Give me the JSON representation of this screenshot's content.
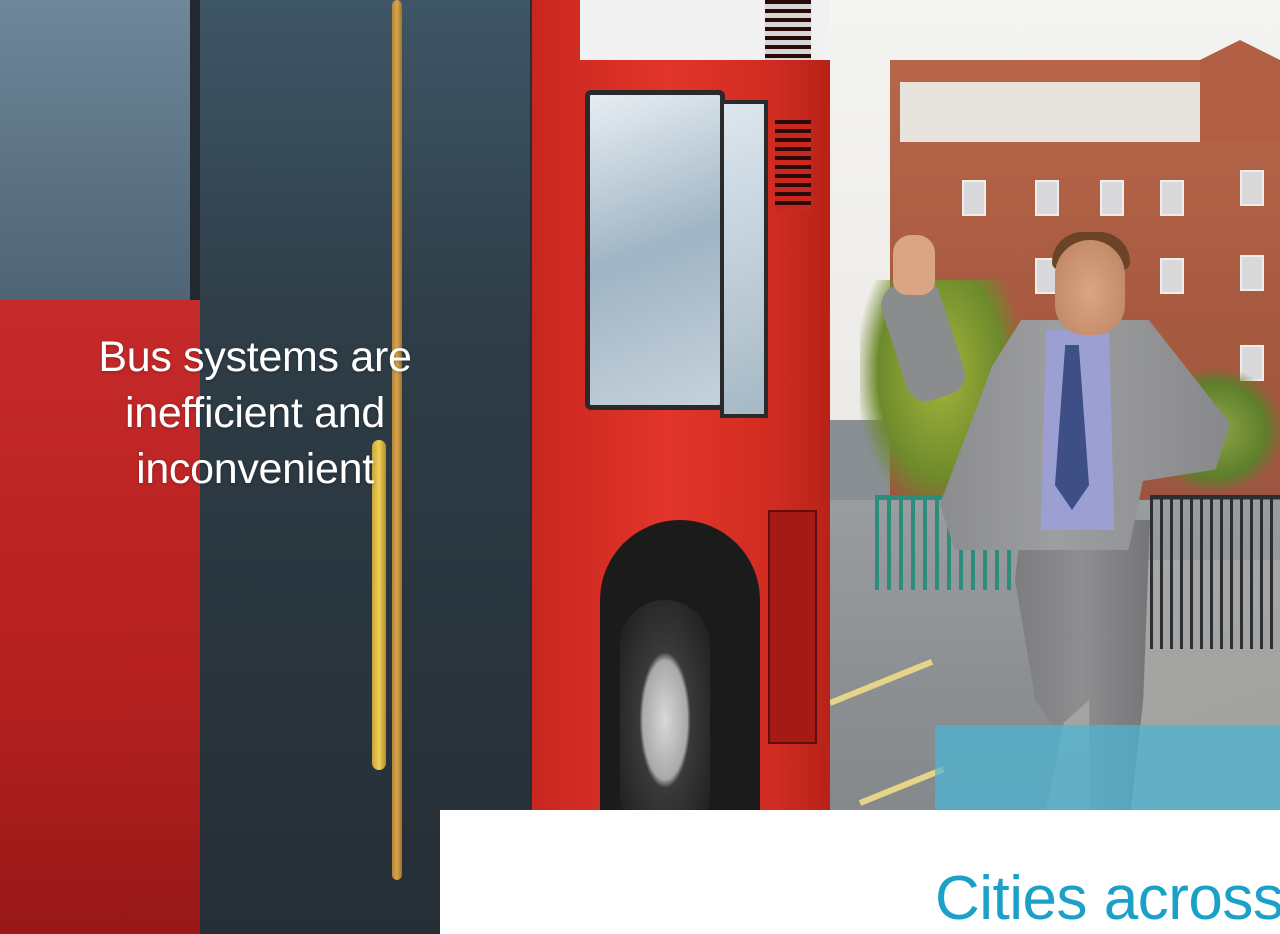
{
  "overlay_text": {
    "line1": "Bus systems are",
    "line2": "inefficient and",
    "line3": "inconvenient"
  },
  "headline": "Cities across",
  "photo": {
    "label": "Photo of a man running to catch a red bus"
  },
  "colors": {
    "accent": "#4bb6d4",
    "headline": "#1ba0c8",
    "overlay_text": "#ffffff",
    "panel": "#ffffff"
  }
}
